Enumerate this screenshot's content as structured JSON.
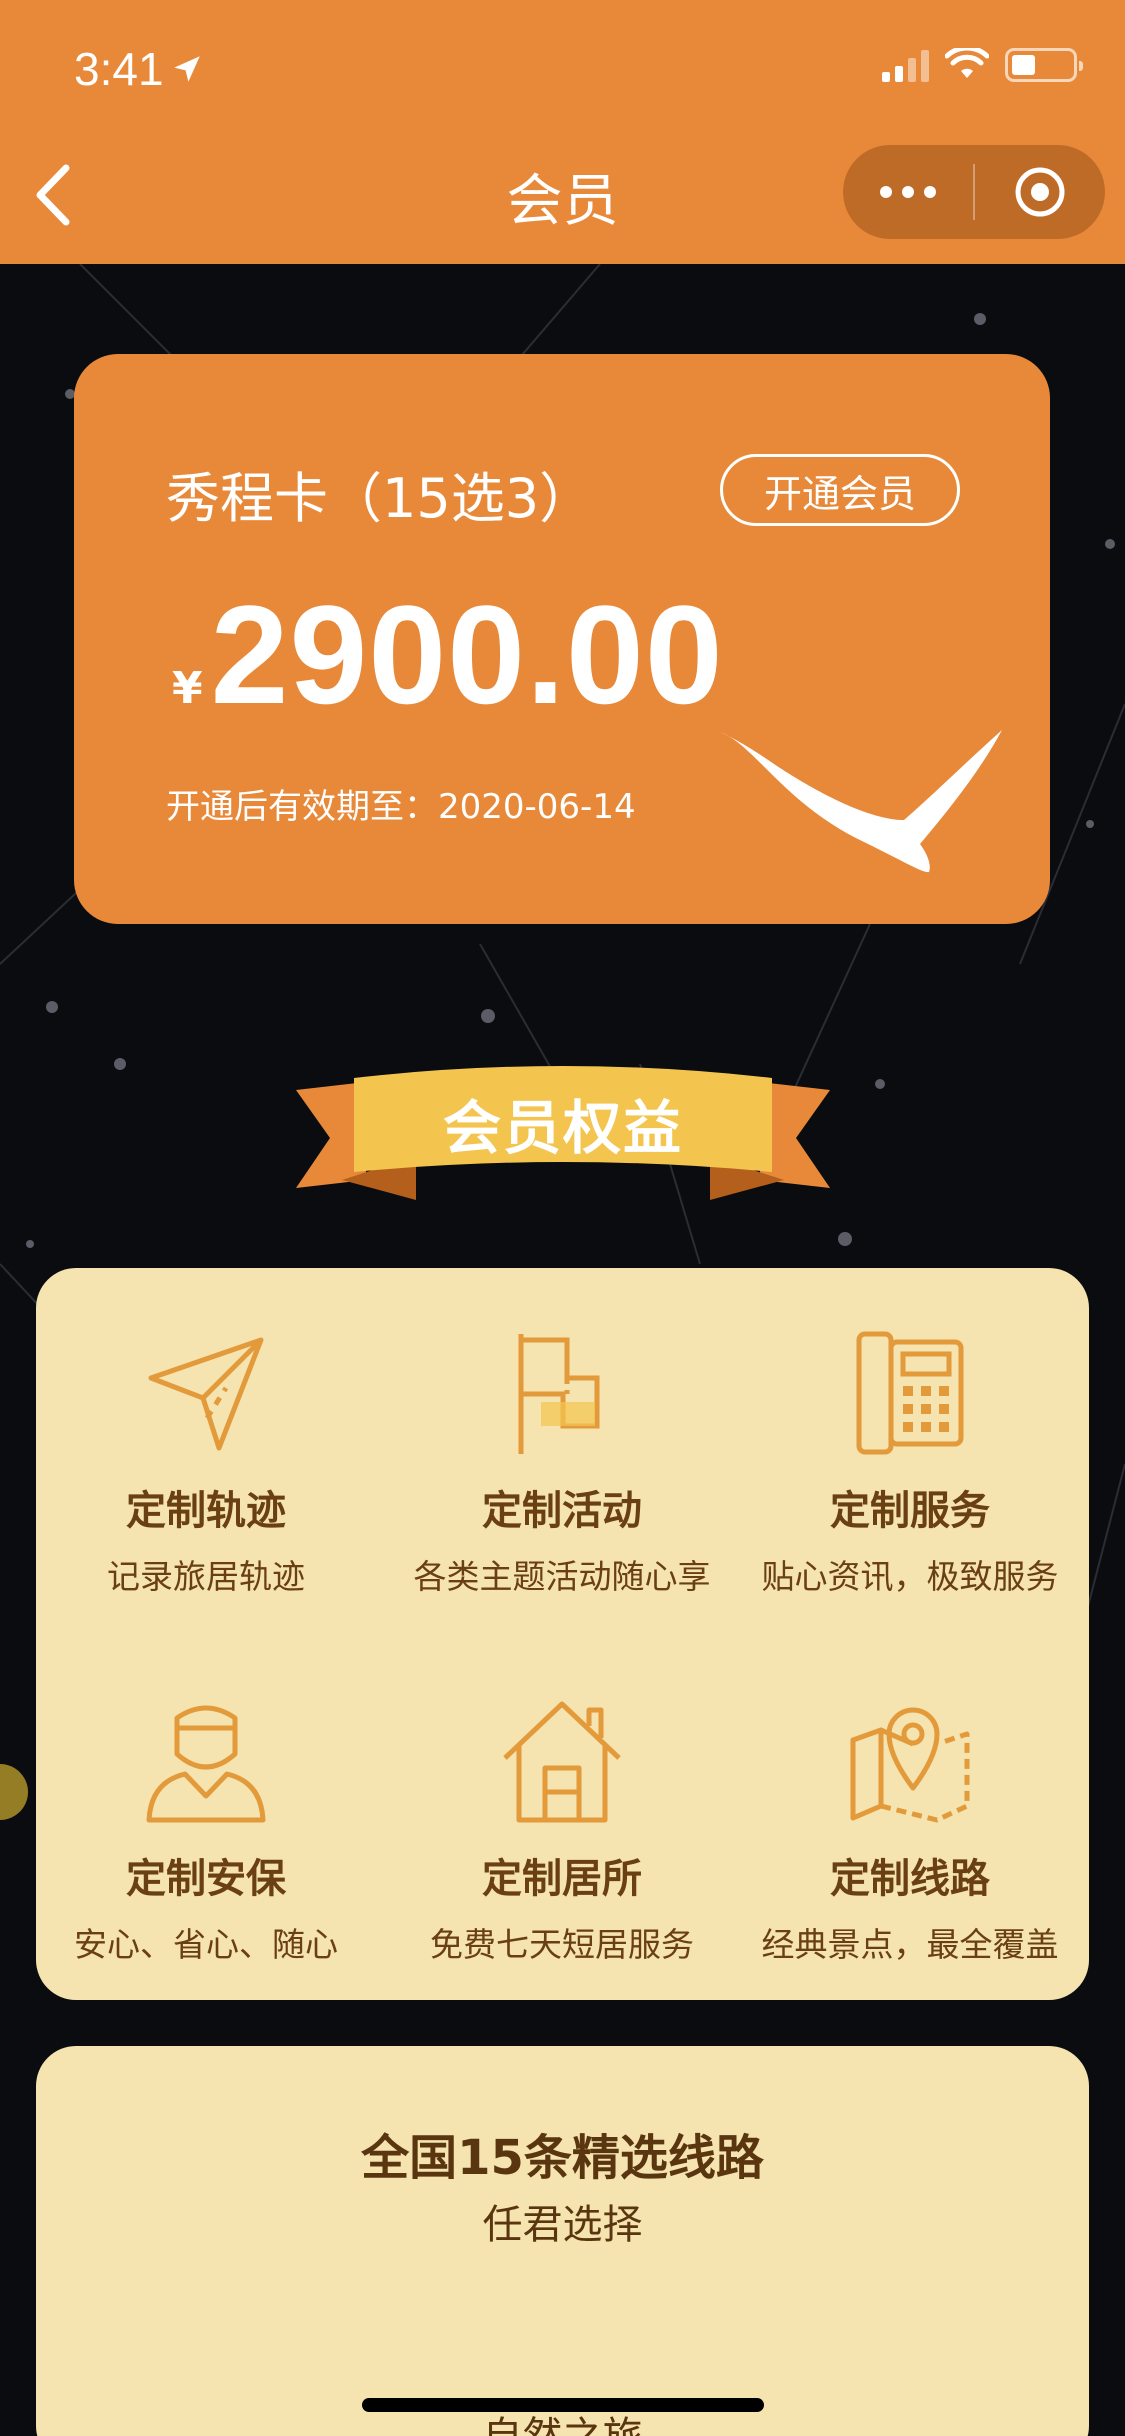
{
  "status_bar": {
    "time": "3:41",
    "icons": [
      "location-arrow-icon",
      "signal-icon",
      "wifi-icon",
      "battery-icon"
    ],
    "battery_level": 0.4
  },
  "nav": {
    "title": "会员",
    "back_icon": "chevron-left-icon",
    "more_icon": "more-dots-icon",
    "close_icon": "target-circle-icon"
  },
  "card": {
    "name": "秀程卡（15选3）",
    "open_button": "开通会员",
    "currency": "¥",
    "price": "2900.00",
    "expiry": "开通后有效期至：2020-06-14",
    "logo_icon": "bird-logo-icon"
  },
  "benefits_heading": "会员权益",
  "benefits": [
    {
      "icon": "paper-plane-icon",
      "title": "定制轨迹",
      "desc": "记录旅居轨迹"
    },
    {
      "icon": "flag-icon",
      "title": "定制活动",
      "desc": "各类主题活动随心享"
    },
    {
      "icon": "phone-icon",
      "title": "定制服务",
      "desc": "贴心资讯，极致服务"
    },
    {
      "icon": "security-person-icon",
      "title": "定制安保",
      "desc": "安心、省心、随心"
    },
    {
      "icon": "house-icon",
      "title": "定制居所",
      "desc": "免费七天短居服务"
    },
    {
      "icon": "map-pin-icon",
      "title": "定制线路",
      "desc": "经典景点，最全覆盖"
    }
  ],
  "routes": {
    "title": "全国15条精选线路",
    "subtitle": "任君选择",
    "footer": "—— 自然之旅 ——"
  },
  "colors": {
    "brand_orange": "#E8893A",
    "panel_cream": "#F5E3B0",
    "benefit_icon": "#E39A3A",
    "text_brown": "#6a3f12",
    "background": "#0b0c10"
  }
}
